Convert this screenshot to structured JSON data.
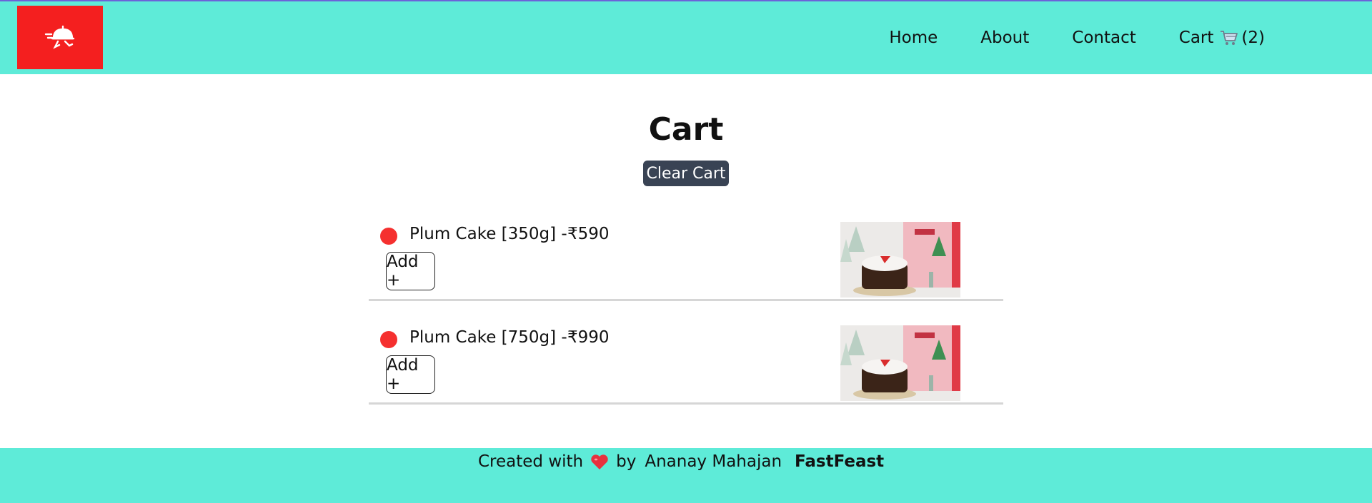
{
  "nav": {
    "home": "Home",
    "about": "About",
    "contact": "Contact",
    "cart_label": "Cart",
    "cart_count": "(2)"
  },
  "page": {
    "title": "Cart",
    "clear_label": "Clear Cart"
  },
  "items": [
    {
      "name": "Plum Cake [350g] -",
      "price": "₹590",
      "add_label": "Add +"
    },
    {
      "name": "Plum Cake [750g] -",
      "price": "₹990",
      "add_label": "Add +"
    }
  ],
  "footer": {
    "created_with": "Created with",
    "by": "by",
    "author": "Ananay Mahajan",
    "brand": "FastFeast"
  },
  "colors": {
    "header_bg": "#5eebd8",
    "logo_bg": "#f41f1f",
    "button_dark": "#394354",
    "veg_dot": "#f5302f"
  },
  "icons": {
    "logo": "delivery-cloche-icon",
    "cart": "shopping-cart-icon",
    "heart": "heart-icon"
  }
}
